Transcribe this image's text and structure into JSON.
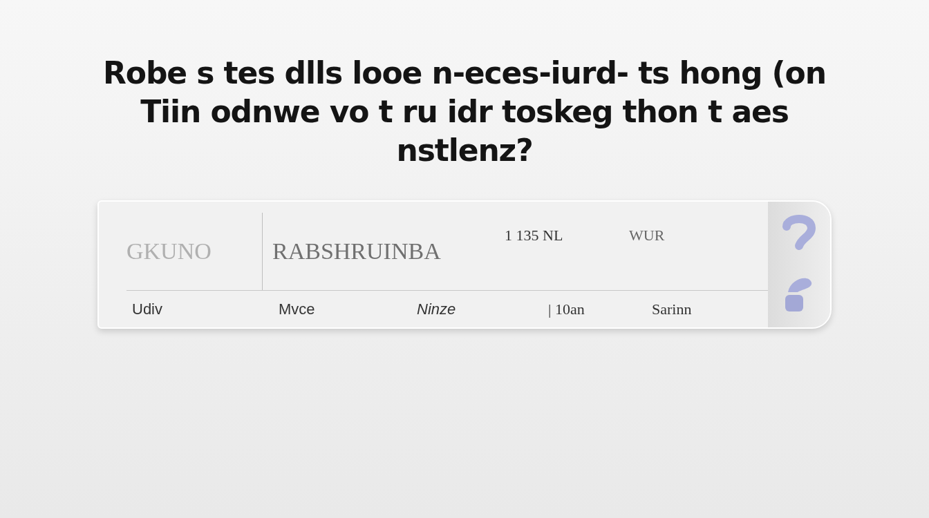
{
  "heading_lines": [
    "Robe s tes dlls looe n-eces-iurd- ts hong (on",
    "Tiin odnwe vo t ru idr toskeg thon t aes",
    "nstlenz?"
  ],
  "card": {
    "header_cells": [
      "GKUNO",
      "RABSHRUINBA",
      "1 135 NL",
      "WUR"
    ],
    "footer_cells": [
      "Udiv",
      "Mvce",
      "Ninze",
      "| 10an",
      "Sarinn"
    ]
  }
}
